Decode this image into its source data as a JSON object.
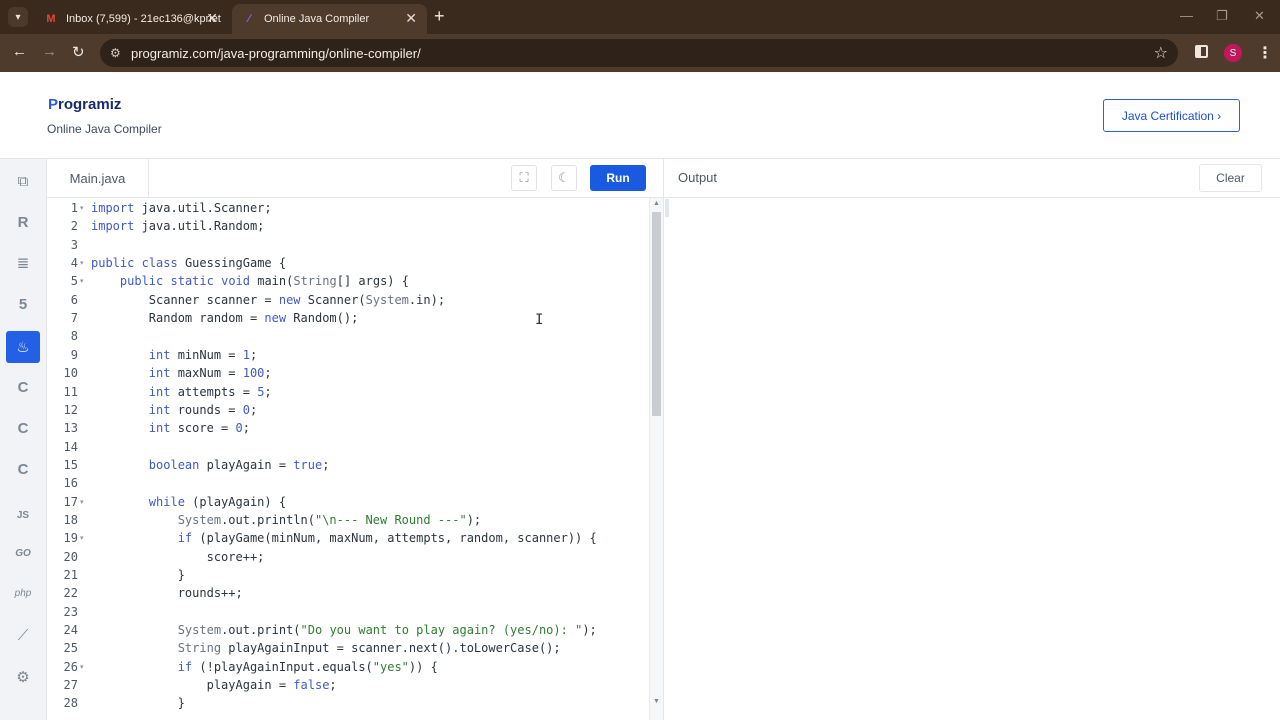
{
  "browser": {
    "tabs": [
      {
        "title": "Inbox (7,599) - 21ec136@kpriet",
        "favicon": "gmail-icon",
        "active": false
      },
      {
        "title": "Online Java Compiler",
        "favicon": "programiz-icon",
        "active": true
      }
    ],
    "url": "programiz.com/java-programming/online-compiler/",
    "profile_initial": "S"
  },
  "header": {
    "logo_text": "rogramiz",
    "logo_initial": "P",
    "subtitle": "Online Java Compiler",
    "cert_button": "Java Certification ›"
  },
  "sidebar": {
    "languages": [
      {
        "name": "python-icon",
        "glyph": "⧉"
      },
      {
        "name": "r-icon",
        "glyph": "R"
      },
      {
        "name": "sql-icon",
        "glyph": "≣"
      },
      {
        "name": "html-icon",
        "glyph": "5"
      },
      {
        "name": "java-icon",
        "glyph": "♨",
        "active": true
      },
      {
        "name": "c-icon",
        "glyph": "C"
      },
      {
        "name": "cpp-icon",
        "glyph": "C"
      },
      {
        "name": "csharp-icon",
        "glyph": "C"
      },
      {
        "name": "js-icon",
        "glyph": "JS"
      },
      {
        "name": "go-icon",
        "glyph": "GO"
      },
      {
        "name": "php-icon",
        "glyph": "php"
      },
      {
        "name": "swift-icon",
        "glyph": "⟋"
      },
      {
        "name": "rust-icon",
        "glyph": "⚙"
      }
    ]
  },
  "editor": {
    "filename": "Main.java",
    "run_label": "Run",
    "lines": [
      {
        "n": "1",
        "fold": true,
        "code": "import java.util.Scanner;"
      },
      {
        "n": "2",
        "fold": false,
        "code": "import java.util.Random;"
      },
      {
        "n": "3",
        "fold": false,
        "code": ""
      },
      {
        "n": "4",
        "fold": true,
        "code": "public class GuessingGame {"
      },
      {
        "n": "5",
        "fold": true,
        "code": "    public static void main(String[] args) {"
      },
      {
        "n": "6",
        "fold": false,
        "code": "        Scanner scanner = new Scanner(System.in);"
      },
      {
        "n": "7",
        "fold": false,
        "code": "        Random random = new Random();"
      },
      {
        "n": "8",
        "fold": false,
        "code": ""
      },
      {
        "n": "9",
        "fold": false,
        "code": "        int minNum = 1;"
      },
      {
        "n": "10",
        "fold": false,
        "code": "        int maxNum = 100;"
      },
      {
        "n": "11",
        "fold": false,
        "code": "        int attempts = 5;"
      },
      {
        "n": "12",
        "fold": false,
        "code": "        int rounds = 0;"
      },
      {
        "n": "13",
        "fold": false,
        "code": "        int score = 0;"
      },
      {
        "n": "14",
        "fold": false,
        "code": ""
      },
      {
        "n": "15",
        "fold": false,
        "code": "        boolean playAgain = true;"
      },
      {
        "n": "16",
        "fold": false,
        "code": ""
      },
      {
        "n": "17",
        "fold": true,
        "code": "        while (playAgain) {"
      },
      {
        "n": "18",
        "fold": false,
        "code": "            System.out.println(\"\\n--- New Round ---\");"
      },
      {
        "n": "19",
        "fold": true,
        "code": "            if (playGame(minNum, maxNum, attempts, random, scanner)) {"
      },
      {
        "n": "20",
        "fold": false,
        "code": "                score++;"
      },
      {
        "n": "21",
        "fold": false,
        "code": "            }"
      },
      {
        "n": "22",
        "fold": false,
        "code": "            rounds++;"
      },
      {
        "n": "23",
        "fold": false,
        "code": ""
      },
      {
        "n": "24",
        "fold": false,
        "code": "            System.out.print(\"Do you want to play again? (yes/no): \");"
      },
      {
        "n": "25",
        "fold": false,
        "code": "            String playAgainInput = scanner.next().toLowerCase();"
      },
      {
        "n": "26",
        "fold": true,
        "code": "            if (!playAgainInput.equals(\"yes\")) {"
      },
      {
        "n": "27",
        "fold": false,
        "code": "                playAgain = false;"
      },
      {
        "n": "28",
        "fold": false,
        "code": "            }"
      }
    ]
  },
  "output": {
    "title": "Output",
    "clear_label": "Clear"
  },
  "colors": {
    "accent": "#1a5ae0",
    "browser_frame": "#3a2a1e",
    "keyword": "#4159c8",
    "string": "#2f7d32"
  }
}
